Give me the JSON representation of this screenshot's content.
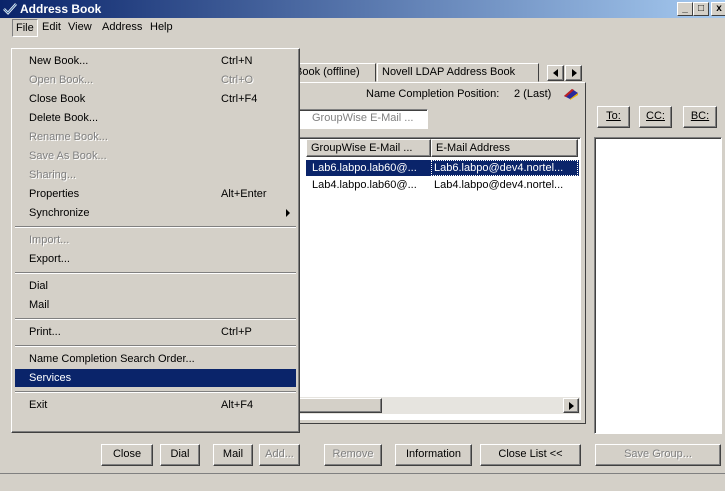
{
  "window": {
    "title": "Address Book",
    "controls": [
      "_",
      "□",
      "x"
    ]
  },
  "menubar": [
    "File",
    "Edit",
    "View",
    "Address",
    "Help"
  ],
  "tabs": [
    "Book (offline)",
    "Novell LDAP Address Book"
  ],
  "name_completion": {
    "label": "Name Completion Position:",
    "value": "2 (Last)"
  },
  "search": {
    "placeholder": "GroupWise E-Mail ..."
  },
  "table": {
    "columns": [
      "GroupWise E-Mail ...",
      "E-Mail Address"
    ],
    "rows": [
      {
        "gw": "Lab6.labpo.lab60@...",
        "email": "Lab6.labpo@dev4.nortel..."
      },
      {
        "gw": "Lab4.labpo.lab60@...",
        "email": "Lab4.labpo@dev4.nortel..."
      }
    ]
  },
  "recipients": {
    "to": "To:",
    "cc": "CC:",
    "bc": "BC:"
  },
  "bottom_buttons": {
    "close": "Close",
    "dial": "Dial",
    "mail": "Mail",
    "add": "Add...",
    "remove": "Remove",
    "information": "Information",
    "close_list": "Close List <<",
    "save_group": "Save Group..."
  },
  "file_menu": [
    {
      "label": "New Book...",
      "shortcut": "Ctrl+N",
      "state": "enabled"
    },
    {
      "label": "Open Book...",
      "shortcut": "Ctrl+O",
      "state": "disabled"
    },
    {
      "label": "Close Book",
      "shortcut": "Ctrl+F4",
      "state": "enabled"
    },
    {
      "label": "Delete Book...",
      "shortcut": "",
      "state": "enabled"
    },
    {
      "label": "Rename Book...",
      "shortcut": "",
      "state": "disabled"
    },
    {
      "label": "Save As Book...",
      "shortcut": "",
      "state": "disabled"
    },
    {
      "label": "Sharing...",
      "shortcut": "",
      "state": "disabled"
    },
    {
      "label": "Properties",
      "shortcut": "Alt+Enter",
      "state": "enabled"
    },
    {
      "label": "Synchronize",
      "shortcut": "",
      "state": "enabled",
      "submenu": true
    },
    {
      "separator": true
    },
    {
      "label": "Import...",
      "shortcut": "",
      "state": "disabled"
    },
    {
      "label": "Export...",
      "shortcut": "",
      "state": "enabled"
    },
    {
      "separator": true
    },
    {
      "label": "Dial",
      "shortcut": "",
      "state": "enabled"
    },
    {
      "label": "Mail",
      "shortcut": "",
      "state": "enabled"
    },
    {
      "separator": true
    },
    {
      "label": "Print...",
      "shortcut": "Ctrl+P",
      "state": "enabled"
    },
    {
      "separator": true
    },
    {
      "label": "Name Completion Search Order...",
      "shortcut": "",
      "state": "enabled"
    },
    {
      "label": "Services",
      "shortcut": "",
      "state": "selected"
    },
    {
      "separator": true
    },
    {
      "label": "Exit",
      "shortcut": "Alt+F4",
      "state": "enabled"
    }
  ],
  "colors": {
    "title_start": "#0a246a",
    "title_end": "#a6caf0",
    "selection": "#0a246a",
    "face": "#d4d0c8"
  }
}
